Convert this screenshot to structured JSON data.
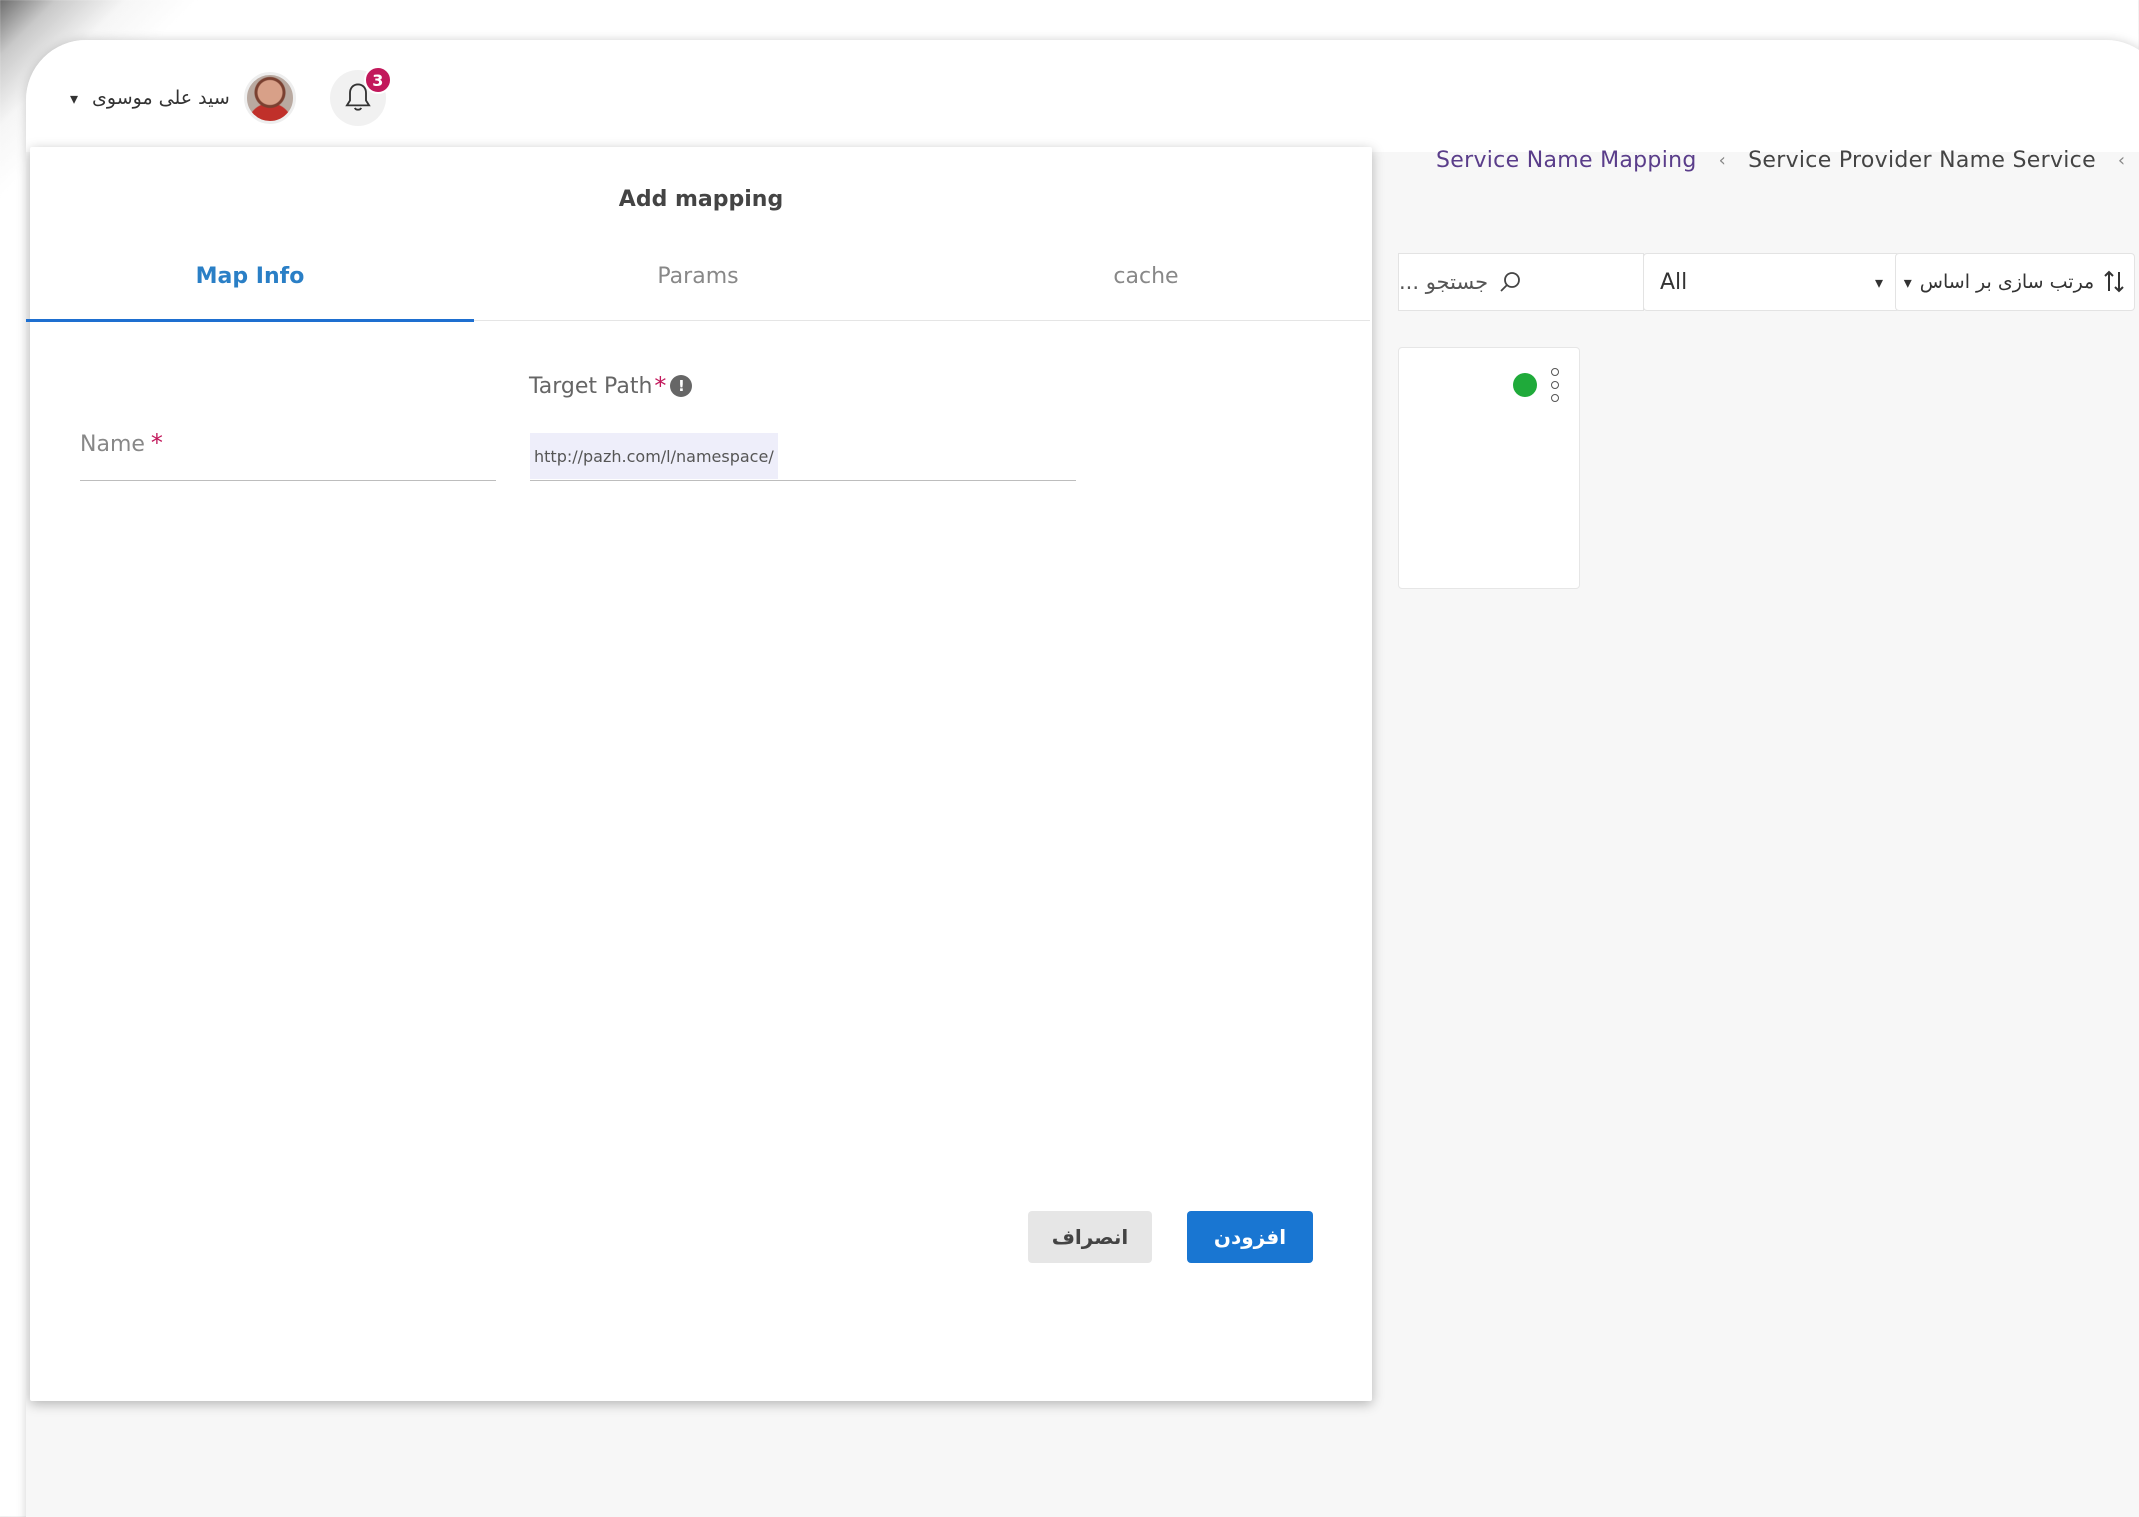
{
  "header": {
    "user_name": "سید علی موسوی",
    "notification_count": "3"
  },
  "breadcrumb": {
    "items": [
      "Service Name Mapping",
      "Service Provider Name Service"
    ]
  },
  "toolbar": {
    "search_placeholder": "جستجو ...",
    "filter_value": "All",
    "sort_label": "مرتب سازی بر اساس"
  },
  "status": {
    "color": "#1faa3a"
  },
  "modal": {
    "title": "Add mapping",
    "tabs": [
      {
        "label": "Map Info",
        "active": true
      },
      {
        "label": "Params",
        "active": false
      },
      {
        "label": "cache",
        "active": false
      }
    ],
    "fields": {
      "name_label": "Name",
      "target_label": "Target Path",
      "target_prefix": "http://pazh.com/l/namespace/",
      "required_marker": "*"
    },
    "buttons": {
      "cancel": "انصراف",
      "add": "افزودن"
    }
  },
  "colors": {
    "accent": "#1976d2",
    "tab_active": "#2a7fc6",
    "badge": "#c2185b",
    "breadcrumb_active": "#5a3d8a"
  }
}
